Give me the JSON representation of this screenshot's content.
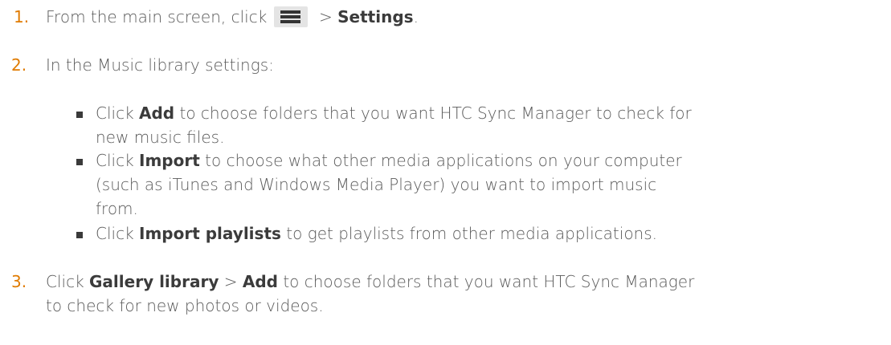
{
  "steps": [
    {
      "number": "1.",
      "before": "From the main screen, click ",
      "icon": "hamburger-menu-icon",
      "after": " > ",
      "bold": "Settings",
      "end": "."
    },
    {
      "number": "2.",
      "text": "In the Music library settings:",
      "bullets": [
        {
          "prefix": "Click ",
          "bold": "Add",
          "line1": " to choose folders that you want HTC Sync Manager to check for",
          "line2": "new music files."
        },
        {
          "prefix": "Click ",
          "bold": "Import",
          "line1": " to choose what other media applications on your computer",
          "line2": "(such as iTunes and Windows Media Player) you want to import music",
          "line3": "from."
        },
        {
          "prefix": "Click ",
          "bold": "Import playlists",
          "line1": " to get playlists from other media applications."
        }
      ]
    },
    {
      "number": "3.",
      "prefix": "Click ",
      "bold1": "Gallery library",
      "middle": " > ",
      "bold2": "Add",
      "line1": " to choose folders that you want HTC Sync Manager",
      "line2": "to check for new photos or videos."
    }
  ],
  "colors": {
    "step_number": "#e07b00",
    "body_text": "#5a5a5a",
    "emphasis_text": "#3b3b3b",
    "icon_background": "#e4e4e4"
  }
}
